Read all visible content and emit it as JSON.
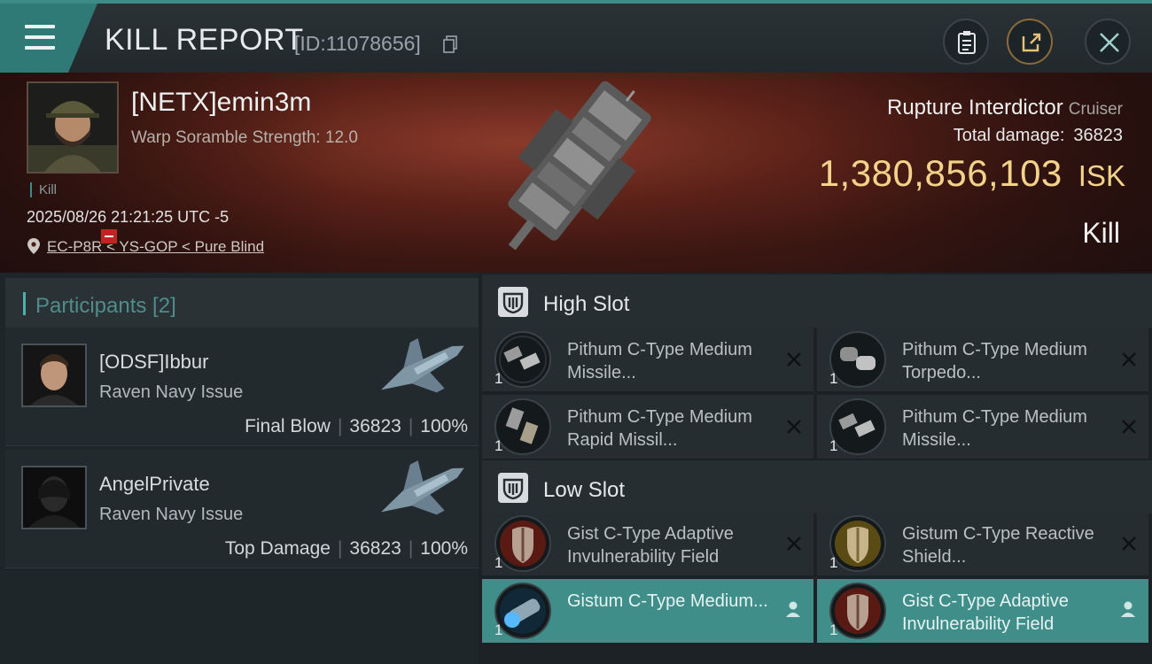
{
  "header": {
    "title": "KILL REPORT",
    "report_id": "[ID:11078656]"
  },
  "victim": {
    "name": "[NETX]emin3m",
    "warp_info": "Warp Soramble Strength: 12.0",
    "status_tag": "Kill",
    "datetime": "2025/08/26 21:21:25 UTC -5",
    "location": "EC-P8R < YS-GOP < Pure Blind",
    "ship_name": "Rupture Interdictor",
    "ship_class": "Cruiser",
    "total_damage_label": "Total damage:",
    "total_damage": "36823",
    "isk_value": "1,380,856,103",
    "isk_unit": "ISK",
    "result": "Kill"
  },
  "participants": {
    "heading": "Participants [2]",
    "rows": [
      {
        "name": "[ODSF]Ibbur",
        "ship": "Raven Navy Issue",
        "role": "Final Blow",
        "damage": "36823",
        "percent": "100%"
      },
      {
        "name": "AngelPrivate",
        "ship": "Raven Navy Issue",
        "role": "Top Damage",
        "damage": "36823",
        "percent": "100%"
      }
    ]
  },
  "slots": {
    "high": {
      "label": "High Slot",
      "items": [
        {
          "name": "Pithum C-Type Medium Missile...",
          "qty": "1",
          "state": "destroyed"
        },
        {
          "name": "Pithum C-Type Medium Torpedo...",
          "qty": "1",
          "state": "destroyed"
        },
        {
          "name": "Pithum C-Type Medium Rapid Missil...",
          "qty": "1",
          "state": "destroyed"
        },
        {
          "name": "Pithum C-Type Medium Missile...",
          "qty": "1",
          "state": "destroyed"
        }
      ]
    },
    "low": {
      "label": "Low Slot",
      "items": [
        {
          "name": "Gist C-Type Adaptive Invulnerability Field",
          "qty": "1",
          "state": "destroyed"
        },
        {
          "name": "Gistum C-Type Reactive Shield...",
          "qty": "1",
          "state": "destroyed"
        },
        {
          "name": "Gistum C-Type Medium...",
          "qty": "1",
          "state": "dropped"
        },
        {
          "name": "Gist C-Type Adaptive Invulnerability Field",
          "qty": "1",
          "state": "dropped"
        }
      ]
    }
  },
  "colors": {
    "accent": "#3f8e8a",
    "isk": "#f3d28a",
    "badge": "#c22323"
  }
}
